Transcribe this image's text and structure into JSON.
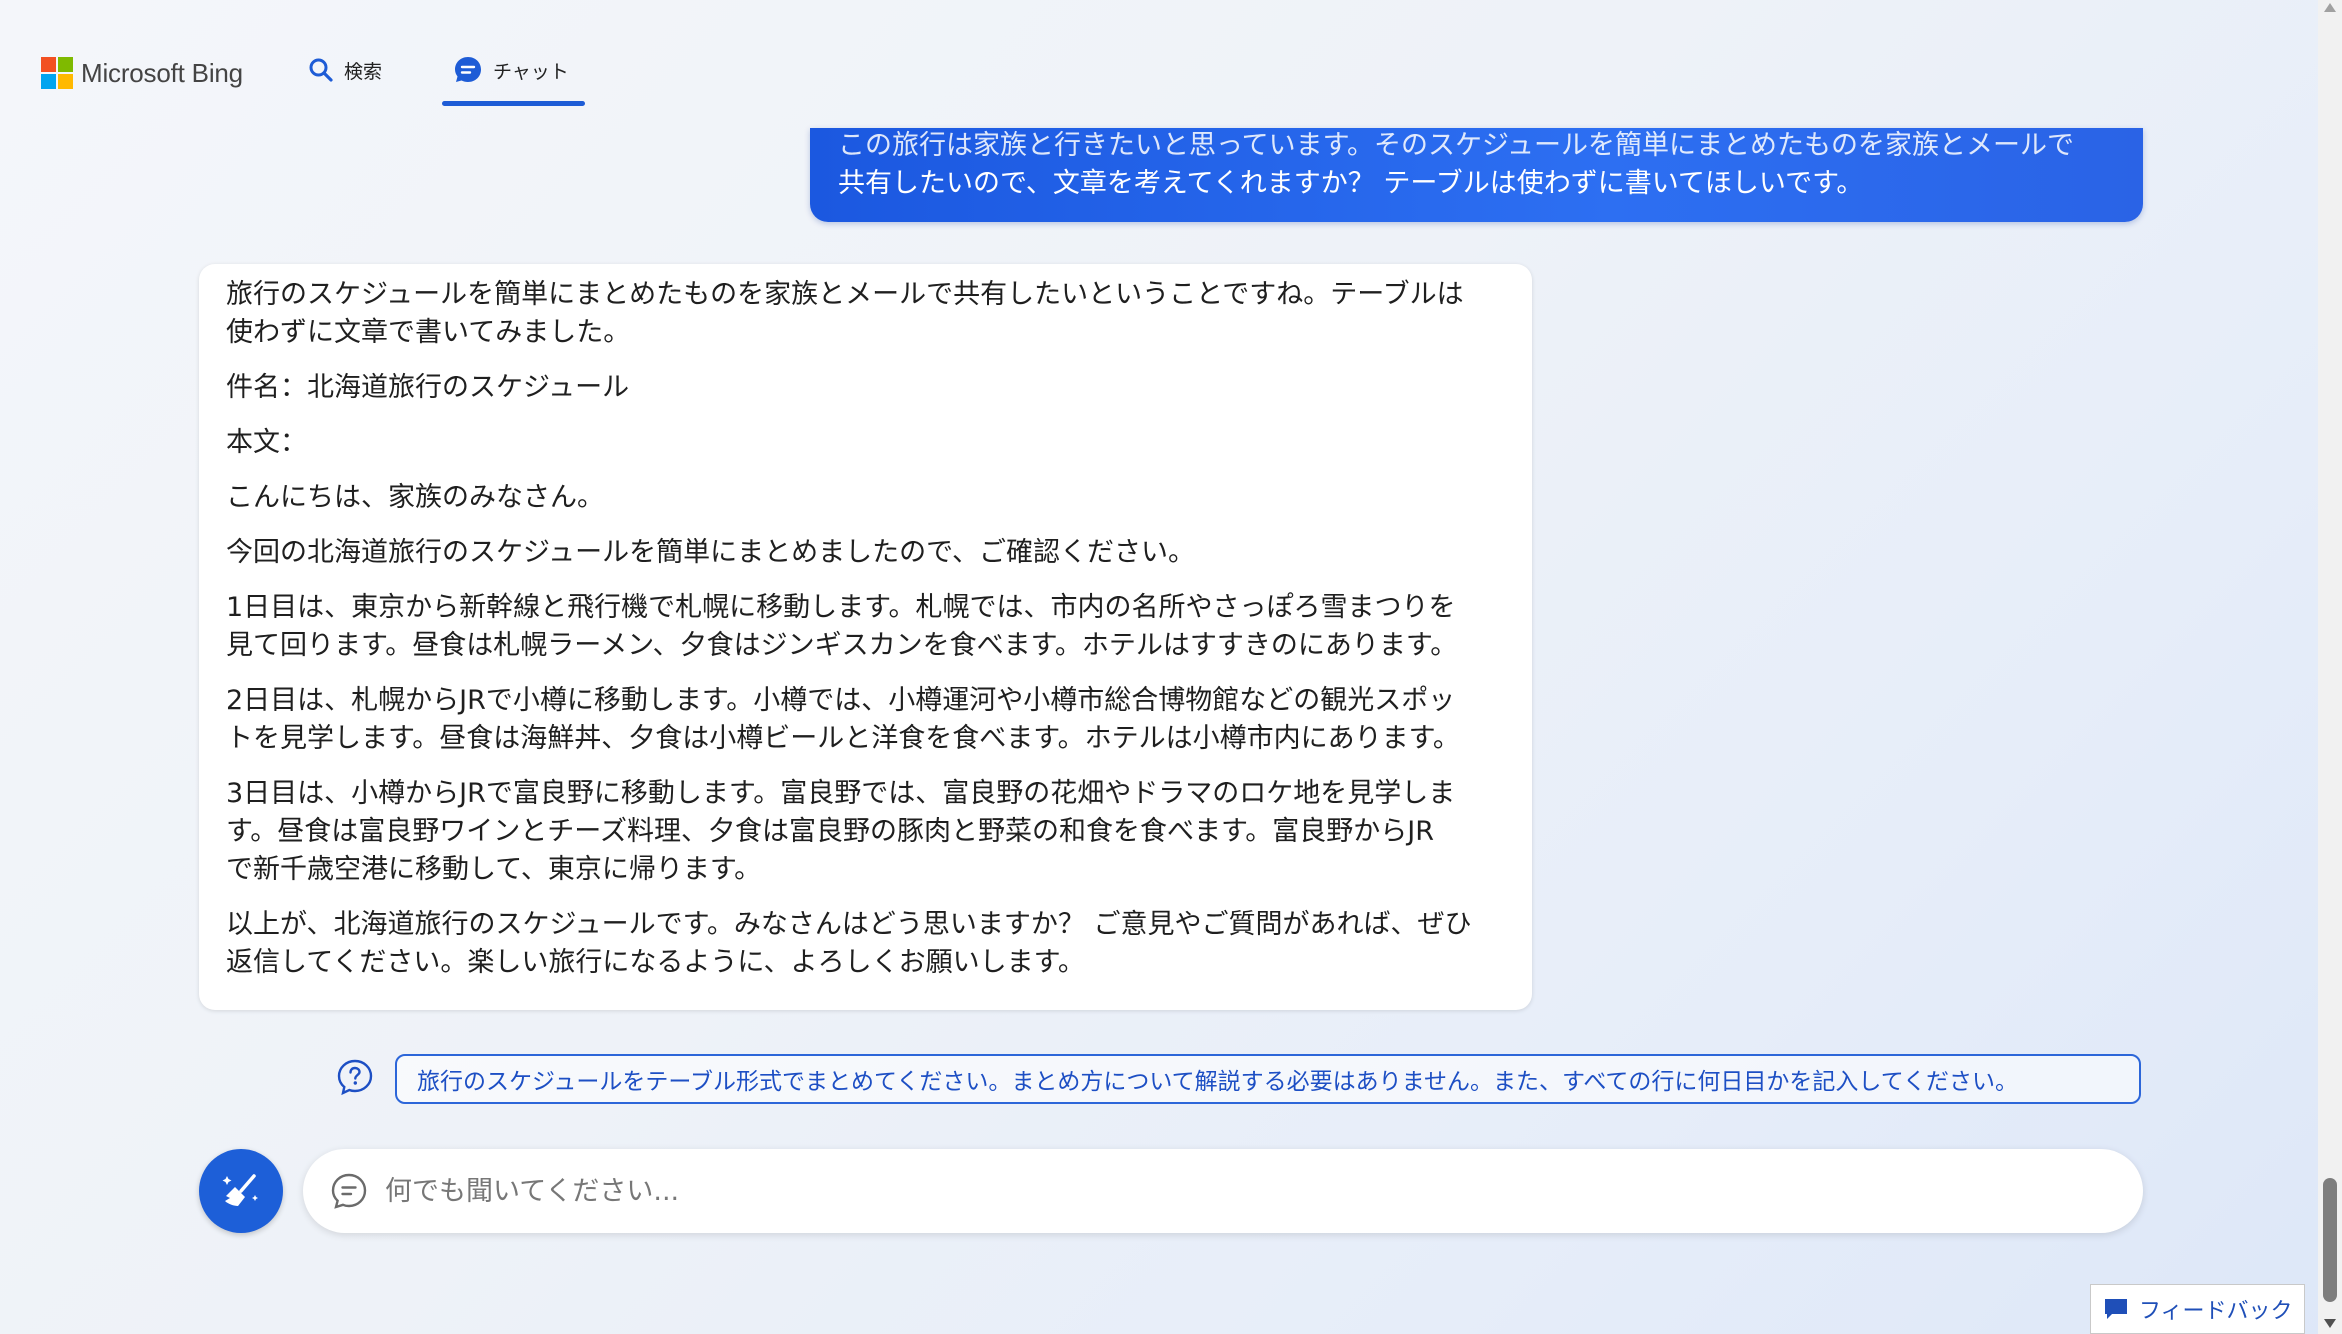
{
  "header": {
    "logo_text": "Microsoft Bing",
    "nav": [
      {
        "label": "検索",
        "icon": "search-icon"
      },
      {
        "label": "チャット",
        "icon": "chat-icon",
        "active": true
      }
    ]
  },
  "user_message": {
    "line1": "この旅行は家族と行きたいと思っています。そのスケジュールを簡単にまとめたものを家族とメールで",
    "line2": "共有したいので、文章を考えてくれますか？ テーブルは使わずに書いてほしいです。"
  },
  "bot_message": {
    "intro": [
      "旅行のスケジュールを簡単にまとめたものを家族とメールで共有したいということですね。テーブルは",
      "使わずに文章で書いてみました。"
    ],
    "subject": "件名：北海道旅行のスケジュール",
    "body_label": "本文：",
    "greeting": "こんにちは、家族のみなさん。",
    "lead": "今回の北海道旅行のスケジュールを簡単にまとめましたので、ご確認ください。",
    "day1": [
      "1日目は、東京から新幹線と飛行機で札幌に移動します。札幌では、市内の名所やさっぽろ雪まつりを",
      "見て回ります。昼食は札幌ラーメン、夕食はジンギスカンを食べます。ホテルはすすきのにあります。"
    ],
    "day2": [
      "2日目は、札幌からJRで小樽に移動します。小樽では、小樽運河や小樽市総合博物館などの観光スポッ",
      "トを見学します。昼食は海鮮丼、夕食は小樽ビールと洋食を食べます。ホテルは小樽市内にあります。"
    ],
    "day3": [
      "3日目は、小樽からJRで富良野に移動します。富良野では、富良野の花畑やドラマのロケ地を見学しま",
      "す。昼食は富良野ワインとチーズ料理、夕食は富良野の豚肉と野菜の和食を食べます。富良野からJR",
      "で新千歳空港に移動して、東京に帰ります。"
    ],
    "closing": [
      "以上が、北海道旅行のスケジュールです。みなさんはどう思いますか？ ご意見やご質問があれば、ぜひ",
      "返信してください。楽しい旅行になるように、よろしくお願いします。"
    ]
  },
  "suggestion": {
    "text": "旅行のスケジュールをテーブル形式でまとめてください。まとめ方について解説する必要はありません。また、すべての行に何日目かを記入してください。"
  },
  "input": {
    "placeholder": "何でも聞いてください..."
  },
  "feedback": {
    "label": "フィードバック"
  },
  "colors": {
    "accent": "#1e5cd6",
    "user_bubble": "#2563eb",
    "suggestion_text": "#1d4fc4"
  }
}
